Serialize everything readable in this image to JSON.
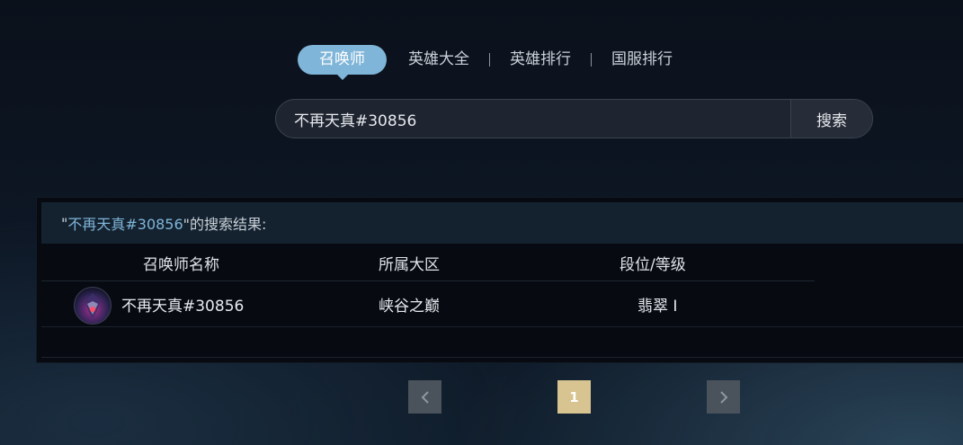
{
  "tabs": [
    {
      "label": "召唤师",
      "active": true
    },
    {
      "label": "英雄大全",
      "active": false
    },
    {
      "label": "英雄排行",
      "active": false
    },
    {
      "label": "国服排行",
      "active": false
    }
  ],
  "search": {
    "value": "不再天真#30856",
    "button_label": "搜索"
  },
  "results": {
    "title_quote_open": "\"",
    "keyword": "不再天真#30856",
    "title_suffix": " \"的搜索结果:",
    "headers": [
      "召唤师名称",
      "所属大区",
      "段位/等级"
    ],
    "rows": [
      {
        "name": "不再天真#30856",
        "region": "峡谷之巅",
        "rank": "翡翠 Ⅰ"
      }
    ]
  },
  "pagination": {
    "current_page": "1",
    "prev_icon": "chevron-left",
    "next_icon": "chevron-right"
  },
  "colors": {
    "accent": "#7fb5d8",
    "page_active": "#d8c490"
  }
}
